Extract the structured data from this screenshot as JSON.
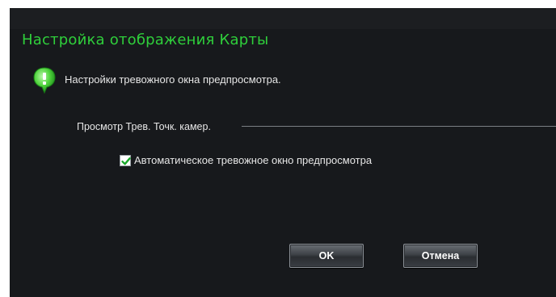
{
  "dialog": {
    "title": "Настройка отображения Карты",
    "subtitle": "Настройки тревожного окна предпросмотра.",
    "info_icon": "info-bubble-icon",
    "group": {
      "label": "Просмотр Трев. Точк. камер."
    },
    "checkbox": {
      "label": "Автоматическое тревожное окно предпросмотра",
      "checked": true
    },
    "buttons": {
      "ok_label": "OK",
      "cancel_label": "Отмена"
    }
  },
  "colors": {
    "background": "#17191c",
    "title": "#2fcf3b",
    "text": "#e6e6e6",
    "check": "#1aa82a"
  }
}
